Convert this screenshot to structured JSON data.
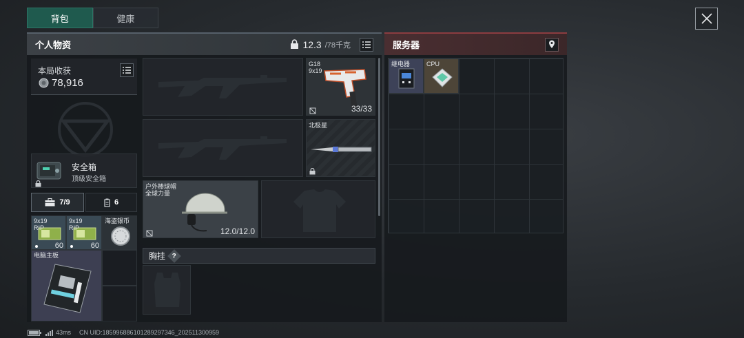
{
  "tabs": [
    {
      "label": "背包",
      "active": true
    },
    {
      "label": "健康",
      "active": false
    }
  ],
  "inventory": {
    "title": "个人物资",
    "weight_current": "12.3",
    "weight_max": "/78千克"
  },
  "server": {
    "title": "服务器"
  },
  "earnings": {
    "label": "本局收获",
    "value": "78,916"
  },
  "safe_box": {
    "name": "安全箱",
    "grade": "顶级安全箱"
  },
  "pockets": {
    "bag_count": "7/9",
    "vest_count": "6"
  },
  "pocket_items": [
    {
      "name": "9x19",
      "sub": "RIP",
      "count": "60"
    },
    {
      "name": "9x19",
      "sub": "RIP",
      "count": "60"
    },
    {
      "name": "海盗银币",
      "sub": "",
      "count": ""
    },
    {
      "name": "电脑主板",
      "sub": "",
      "count": ""
    }
  ],
  "weapons": {
    "sidearm": {
      "name": "G18",
      "ammo_type": "9x19",
      "ammo": "33/33"
    },
    "melee": {
      "name": "北极星"
    }
  },
  "helmet": {
    "name": "户外棒球帽",
    "sub": "全球力量",
    "durability": "12.0/12.0"
  },
  "chest_rig": {
    "label": "胸挂",
    "help": "?"
  },
  "server_items": [
    {
      "name": "继电器"
    },
    {
      "name": "CPU"
    }
  ],
  "status": {
    "ping": "43ms",
    "uid": "CN UID:185996886101289297346_202511300959"
  },
  "colors": {
    "accent_green": "#1f5a4e",
    "accent_red": "#8c3c40",
    "coin_white": "#ffffff"
  }
}
